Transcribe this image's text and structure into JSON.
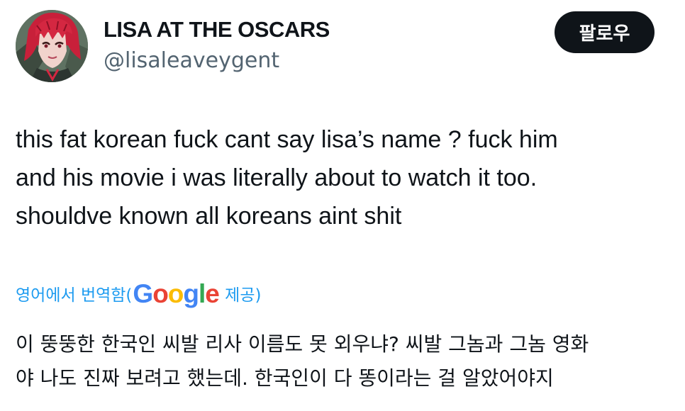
{
  "author": {
    "display_name": "LISA AT THE OSCARS",
    "handle": "@lisaleaveygent",
    "avatar_icon": "anime-avatar-icon"
  },
  "follow_button": {
    "label": "팔로우"
  },
  "tweet": {
    "lines": [
      "this fat korean fuck cant say lisa’s name ? fuck him",
      "and his movie i was literally about to watch it too.",
      "shouldve known all koreans aint shit"
    ]
  },
  "translation": {
    "prefix": "영어에서 번역함(",
    "provider_letters": [
      "G",
      "o",
      "o",
      "g",
      "l",
      "e"
    ],
    "provider_colors": [
      "#4285f4",
      "#ea4335",
      "#fbbc05",
      "#4285f4",
      "#34a853",
      "#ea4335"
    ],
    "suffix": " 제공)",
    "lines": [
      "이 뚱뚱한 한국인 씨발 리사 이름도 못 외우냐? 씨발 그놈과 그놈 영화",
      "야 나도 진짜 보려고 했는데. 한국인이 다 똥이라는 걸 알았어야지"
    ]
  },
  "colors": {
    "text": "#0f1419",
    "secondary": "#536471",
    "link": "#1d9bf0",
    "button_bg": "#0f1419",
    "button_text": "#ffffff"
  }
}
